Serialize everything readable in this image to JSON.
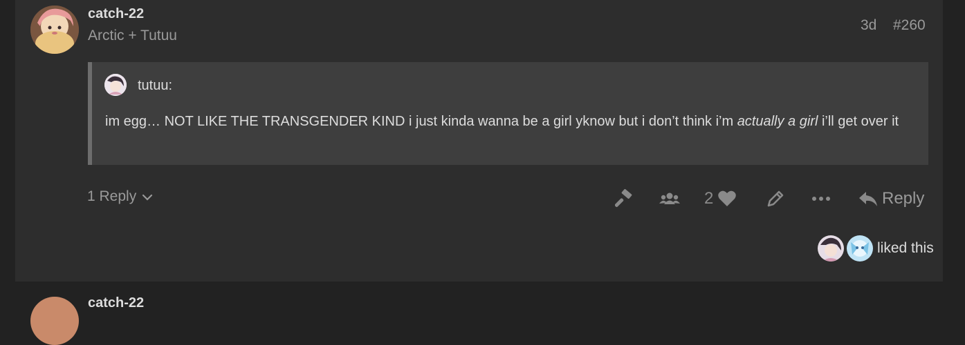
{
  "post": {
    "username": "catch-22",
    "user_title": "Arctic + Tutuu",
    "date": "3d",
    "post_number": "#260",
    "quote": {
      "author": "tutuu:",
      "text_before": "im egg… NOT LIKE THE TRANSGENDER KIND i just kinda wanna be a girl yknow but i don’t think i’m ",
      "text_emphasis": "actually a girl",
      "text_after": " i’ll get over it"
    },
    "replies_label": "1 Reply",
    "like_count": "2",
    "reply_button_label": "Reply",
    "liked_text": "liked this"
  },
  "next_post": {
    "username": "catch-22"
  },
  "colors": {
    "background": "#222222",
    "post_background": "#2d2d2d",
    "quote_background": "#3e3e3e",
    "quote_border": "#6d6d6d",
    "primary_text": "#dddddd",
    "secondary_text": "#9a9a9a"
  },
  "icons": [
    "chevron-down-icon",
    "hammer-icon",
    "users-icon",
    "heart-icon",
    "pencil-icon",
    "ellipsis-icon",
    "reply-arrow-icon"
  ]
}
